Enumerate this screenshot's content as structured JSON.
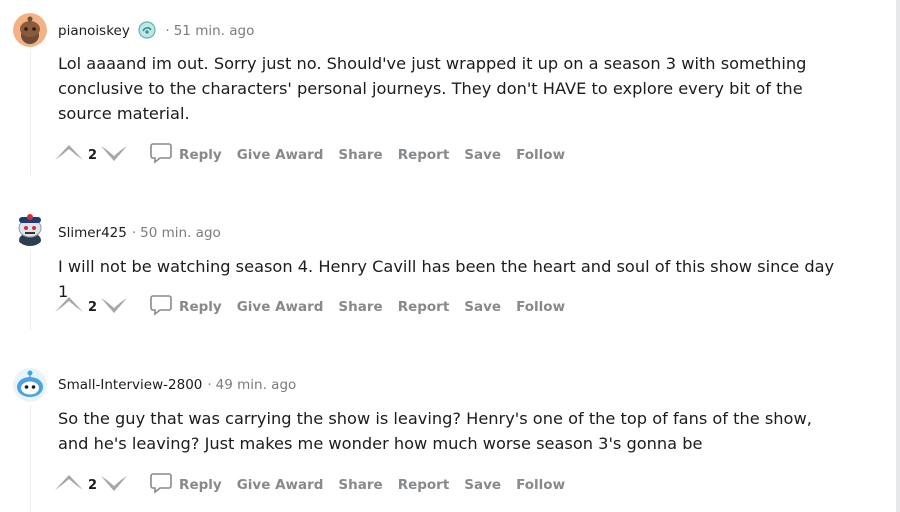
{
  "comments": [
    {
      "username": "pianoiskey",
      "time": "51 min. ago",
      "text": "Lol aaaand im out. Sorry just no. Should've just wrapped it up on a season 3 with something conclusive to the characters' personal journeys. They don't HAVE to explore every bit of the source material.",
      "score": "2",
      "avatar": "orange-snoo-avatar",
      "flair": "flair-badge-icon"
    },
    {
      "username": "Slimer425",
      "time": "50 min. ago",
      "text": "I will not be watching season 4. Henry Cavill has been the heart and soul of this show since day 1",
      "score": "2",
      "avatar": "costume-snoo-avatar"
    },
    {
      "username": "Small-Interview-2800",
      "time": "49 min. ago",
      "text": "So the guy that was carrying the show is leaving? Henry's one of the top of fans of the show, and he's leaving? Just makes me wonder how much worse season 3's gonna be",
      "score": "2",
      "avatar": "blue-snoo-avatar"
    }
  ],
  "actions": {
    "reply": "Reply",
    "give_award": "Give Award",
    "share": "Share",
    "report": "Report",
    "save": "Save",
    "follow": "Follow"
  },
  "colors": {
    "meta": "#7c7c7c",
    "action": "#878a8c",
    "text": "#1c1c1c",
    "thread_line": "#edeff1"
  }
}
